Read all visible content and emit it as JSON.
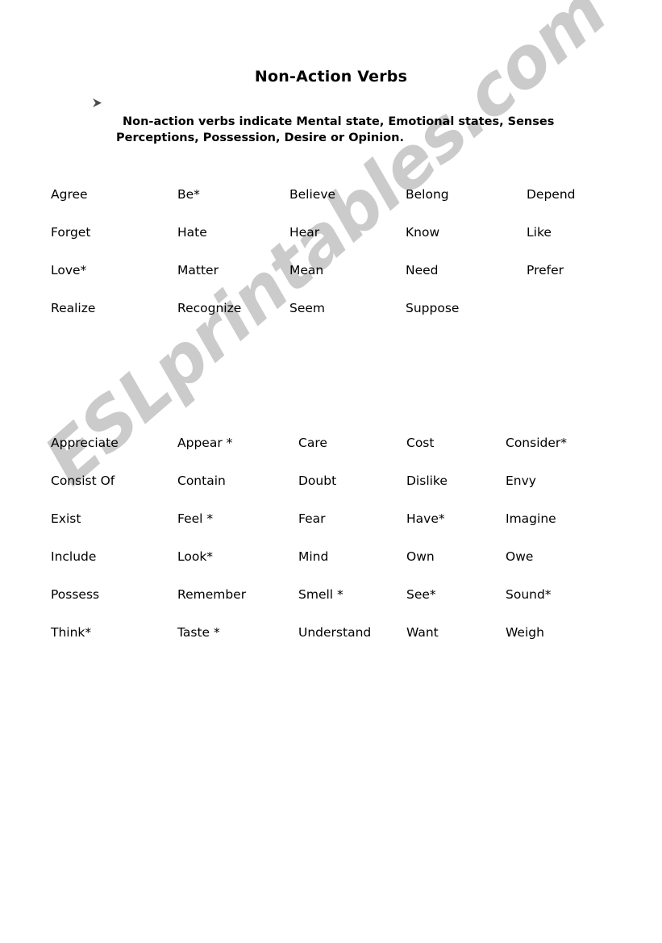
{
  "document": {
    "title": "Non-Action Verbs",
    "intro_bullet_icon": "arrowhead-bullet-icon",
    "intro_line_1": "Non-action verbs indicate Mental state, Emotional states, Senses",
    "intro_line_2": "Perceptions, Possession, Desire or Opinion."
  },
  "watermark": {
    "text": "ESLprintables.com",
    "color": "#cbcbcb"
  },
  "colors": {
    "page_background": "#ffffff",
    "text": "#000000",
    "watermark": "#cbcbcb"
  },
  "verb_table_1": {
    "rows": [
      [
        "Agree",
        "Be*",
        "Believe",
        "Belong",
        "Depend"
      ],
      [
        "Forget",
        "Hate",
        "Hear",
        "Know",
        "Like"
      ],
      [
        "Love*",
        "Matter",
        "Mean",
        "Need",
        "Prefer"
      ],
      [
        "Realize",
        "Recognize",
        "Seem",
        "Suppose",
        ""
      ]
    ]
  },
  "verb_table_2": {
    "rows": [
      [
        "Appreciate",
        "Appear *",
        "Care",
        "Cost",
        "Consider*"
      ],
      [
        "Consist Of",
        "Contain",
        "Doubt",
        "Dislike",
        "Envy"
      ],
      [
        "Exist",
        "Feel *",
        "Fear",
        "Have*",
        "Imagine"
      ],
      [
        "Include",
        "Look*",
        "Mind",
        "Own",
        "Owe"
      ],
      [
        "Possess",
        "Remember",
        "Smell *",
        "See*",
        "Sound*"
      ],
      [
        "Think*",
        "Taste *",
        "Understand",
        "Want",
        "Weigh"
      ]
    ]
  }
}
